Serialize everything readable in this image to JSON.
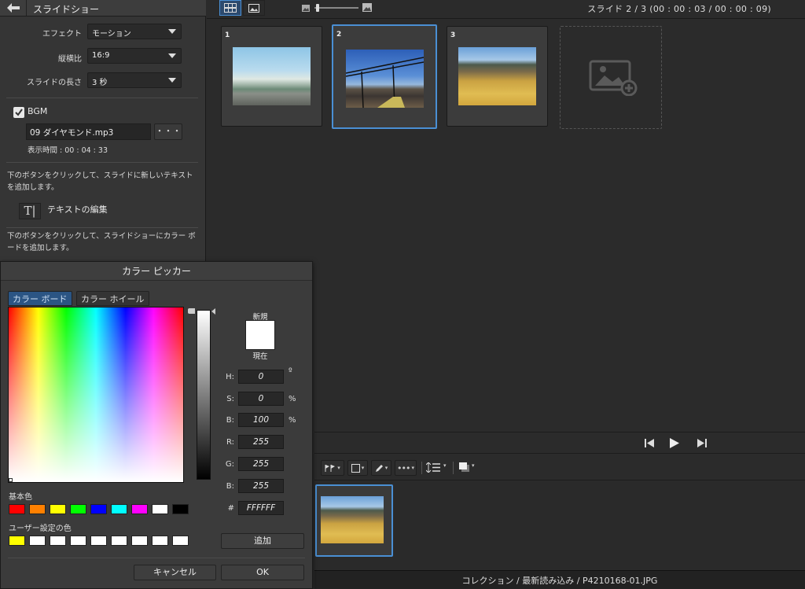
{
  "left_panel": {
    "title": "スライドショー",
    "effect_label": "エフェクト",
    "effect_value": "モーション",
    "aspect_label": "縦横比",
    "aspect_value": "16:9",
    "duration_label": "スライドの長さ",
    "duration_value": "3 秒",
    "bgm_label": "BGM",
    "bgm_checked": true,
    "bgm_file": "09 ダイヤモンド.mp3",
    "bgm_browse": "・・・",
    "bgm_duration": "表示時間 : 00 : 04 : 33",
    "text_help": "下のボタンをクリックして、スライドに新しいテキストを追加します。",
    "text_icon": "T|",
    "text_edit_label": "テキストの編集",
    "colorboard_help": "下のボタンをクリックして、スライドショーにカラー ボードを追加します。"
  },
  "top_bar": {
    "slide_counter": "スライド  2 /  3 (00 : 00 : 03 / 00 : 00 : 09)"
  },
  "slides": [
    {
      "number": "1",
      "selected": false
    },
    {
      "number": "2",
      "selected": true
    },
    {
      "number": "3",
      "selected": false
    }
  ],
  "statusbar": {
    "path": "コレクション / 最新読み込み / P4210168-01.JPG"
  },
  "color_picker": {
    "title": "カラー ピッカー",
    "tabs": [
      "カラー ボード",
      "カラー ホイール"
    ],
    "active_tab": "カラー ボード",
    "new_label": "新規",
    "current_label": "現在",
    "fields": [
      {
        "label": "H:",
        "value": "0",
        "unit": "º"
      },
      {
        "label": "S:",
        "value": "0",
        "unit": "%"
      },
      {
        "label": "B:",
        "value": "100",
        "unit": "%"
      },
      {
        "label": "R:",
        "value": "255",
        "unit": ""
      },
      {
        "label": "G:",
        "value": "255",
        "unit": ""
      },
      {
        "label": "B:",
        "value": "255",
        "unit": ""
      },
      {
        "label": "#",
        "value": "FFFFFF",
        "unit": ""
      }
    ],
    "basic_colors_label": "基本色",
    "basic_colors": [
      "#ff0000",
      "#ff8000",
      "#ffff00",
      "#00ff00",
      "#0000ff",
      "#00ffff",
      "#ff00ff",
      "#ffffff",
      "#000000"
    ],
    "user_colors_label": "ユーザー設定の色",
    "user_colors": [
      "#ffff00",
      "#ffffff",
      "#ffffff",
      "#ffffff",
      "#ffffff",
      "#ffffff",
      "#ffffff",
      "#ffffff",
      "#ffffff"
    ],
    "add_button": "追加",
    "cancel_button": "キャンセル",
    "ok_button": "OK",
    "accent": "#4a8fd4"
  }
}
